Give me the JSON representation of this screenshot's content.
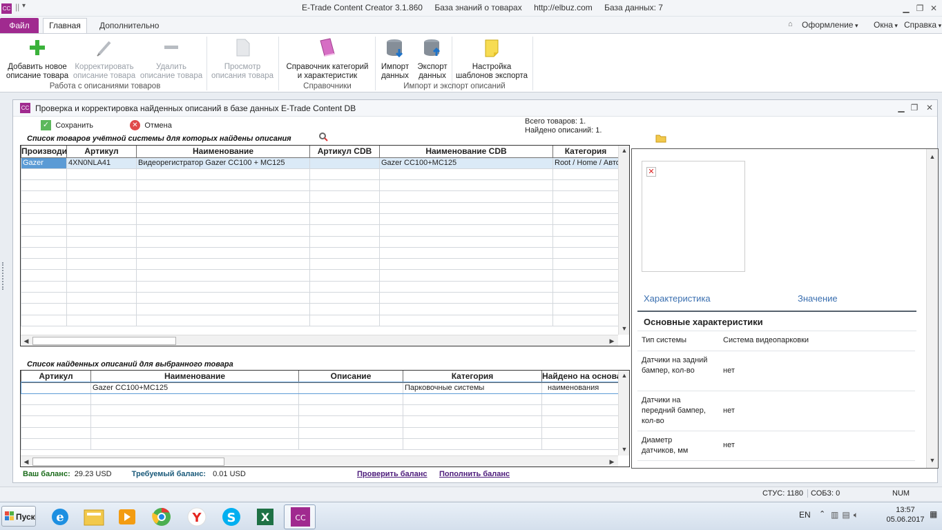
{
  "window": {
    "app_name": "E-Trade Content Creator 3.1.860",
    "kb": "База знаний о товарах",
    "url": "http://elbuz.com",
    "db": "База данных: 7"
  },
  "menu": {
    "file": "Файл",
    "tab_main": "Главная",
    "tab_extra": "Дополнительно",
    "design": "Оформление",
    "windows": "Окна",
    "help": "Справка"
  },
  "ribbon": {
    "add_l1": "Добавить новое",
    "add_l2": "описание товара",
    "edit_l1": "Корректировать",
    "edit_l2": "описание товара",
    "del_l1": "Удалить",
    "del_l2": "описание товара",
    "view_l1": "Просмотр",
    "view_l2": "описания товара",
    "group1": "Работа с описаниями товаров",
    "ref_l1": "Справочник категорий",
    "ref_l2": "и характеристик",
    "group2": "Справочники",
    "import_l1": "Импорт",
    "import_l2": "данных",
    "export_l1": "Экспорт",
    "export_l2": "данных",
    "tmpl_l1": "Настройка",
    "tmpl_l2": "шаблонов экспорта",
    "group3": "Импорт и экспорт описаний"
  },
  "child": {
    "title": "Проверка и корректировка найденных описаний в базе данных E-Trade Content DB",
    "save": "Сохранить",
    "cancel": "Отмена",
    "total": "Всего товаров: 1.",
    "found": "Найдено описаний: 1.",
    "caption_top": "Список товаров учётной системы для которых найдены описания",
    "caption_bottom": "Список найденных описаний для выбранного товара"
  },
  "grid1": {
    "headers": [
      "Производитель",
      "Артикул",
      "Наименование",
      "Артикул CDB",
      "Наименование CDB",
      "Категория"
    ],
    "row": [
      "Gazer",
      "4XN0NLA41",
      "Видеорегистратор Gazer CC100 + MC125",
      "",
      "Gazer CC100+MC125",
      "Root / Home / Авто"
    ]
  },
  "grid2": {
    "headers": [
      "Артикул",
      "Наименование",
      "Описание",
      "Категория",
      "Найдено на основании"
    ],
    "row": [
      "",
      "Gazer CC100+MC125",
      "",
      "Парковочные системы",
      "наименования"
    ]
  },
  "props": {
    "head_char": "Характеристика",
    "head_val": "Значение",
    "section": "Основные характеристики",
    "rows": [
      {
        "k": "Тип системы",
        "v": "Система видеопарковки"
      },
      {
        "k": "Датчики на задний бампер, кол-во",
        "v": "нет"
      },
      {
        "k": "Датчики на передний бампер, кол-во",
        "v": "нет"
      },
      {
        "k": "Диаметр датчиков, мм",
        "v": "нет"
      }
    ]
  },
  "balance": {
    "yours_label": "Ваш баланс:",
    "yours_value": "29.23 USD",
    "req_label": "Требуемый баланс:",
    "req_value": "0.01 USD",
    "check": "Проверить баланс",
    "topup": "Пополнить баланс"
  },
  "status": {
    "stus": "СТУС: 1180",
    "sobz": "СОБЗ: 0",
    "num": "NUM"
  },
  "taskbar": {
    "start": "Пуск",
    "lang": "EN",
    "time": "13:57",
    "date": "05.06.2017"
  },
  "colors": {
    "accent": "#a02a8f",
    "selection": "#5b9bd5",
    "balance_green": "#1a6b1a",
    "link": "#4b1a7a"
  }
}
